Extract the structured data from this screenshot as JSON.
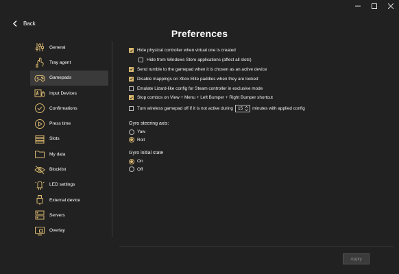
{
  "window": {
    "accent": "#d9b870",
    "controls": [
      "minimize-icon",
      "maximize-icon",
      "close-icon"
    ]
  },
  "nav": {
    "back_label": "Back"
  },
  "header": {
    "title": "Preferences"
  },
  "sidebar": {
    "items": [
      {
        "label": "General",
        "icon": "sliders-icon"
      },
      {
        "label": "Tray agent",
        "icon": "tray-hand-icon"
      },
      {
        "label": "Gamepads",
        "icon": "gamepad-icon",
        "active": true
      },
      {
        "label": "Input Devices",
        "icon": "keyboard-mouse-icon"
      },
      {
        "label": "Confirmations",
        "icon": "check-circle-icon"
      },
      {
        "label": "Press time",
        "icon": "play-circle-icon"
      },
      {
        "label": "Slots",
        "icon": "slots-icon"
      },
      {
        "label": "My data",
        "icon": "folder-icon"
      },
      {
        "label": "Blocklist",
        "icon": "eye-off-icon"
      },
      {
        "label": "LED settings",
        "icon": "led-icon"
      },
      {
        "label": "External device",
        "icon": "usb-icon"
      },
      {
        "label": "Servers",
        "icon": "servers-icon"
      },
      {
        "label": "Overlay",
        "icon": "overlay-icon"
      }
    ]
  },
  "options": {
    "hide_physical": {
      "label": "Hide physical controller when virtual one is created",
      "checked": true
    },
    "hide_store": {
      "label": "Hide from Windows Store applications (affect all slots)",
      "checked": false
    },
    "send_rumble": {
      "label": "Send rumble to the gamepad when it is chosen as an active device",
      "checked": true
    },
    "disable_paddles": {
      "label": "Disable mappings on Xbox Elite paddles when they are locked",
      "checked": true
    },
    "emulate_lizard": {
      "label": "Emulate Lizard-like config for Steam controller in exclusive mode",
      "checked": false
    },
    "stop_combos": {
      "label": "Stop combos on View + Menu + Left Bumper + Right Bumper shortcut",
      "checked": true
    },
    "turn_off": {
      "label_before": "Turn wireless gamepad off if it is not active during",
      "minutes": "15",
      "label_after": "minutes with applied config",
      "checked": false
    }
  },
  "gyro_axis": {
    "title": "Gyro steering axis:",
    "options": [
      "Yaw",
      "Roll"
    ],
    "selected": "Roll"
  },
  "gyro_state": {
    "title": "Gyro initial state",
    "options": [
      "On",
      "Off"
    ],
    "selected": "On"
  },
  "footer": {
    "apply_label": "Apply"
  }
}
